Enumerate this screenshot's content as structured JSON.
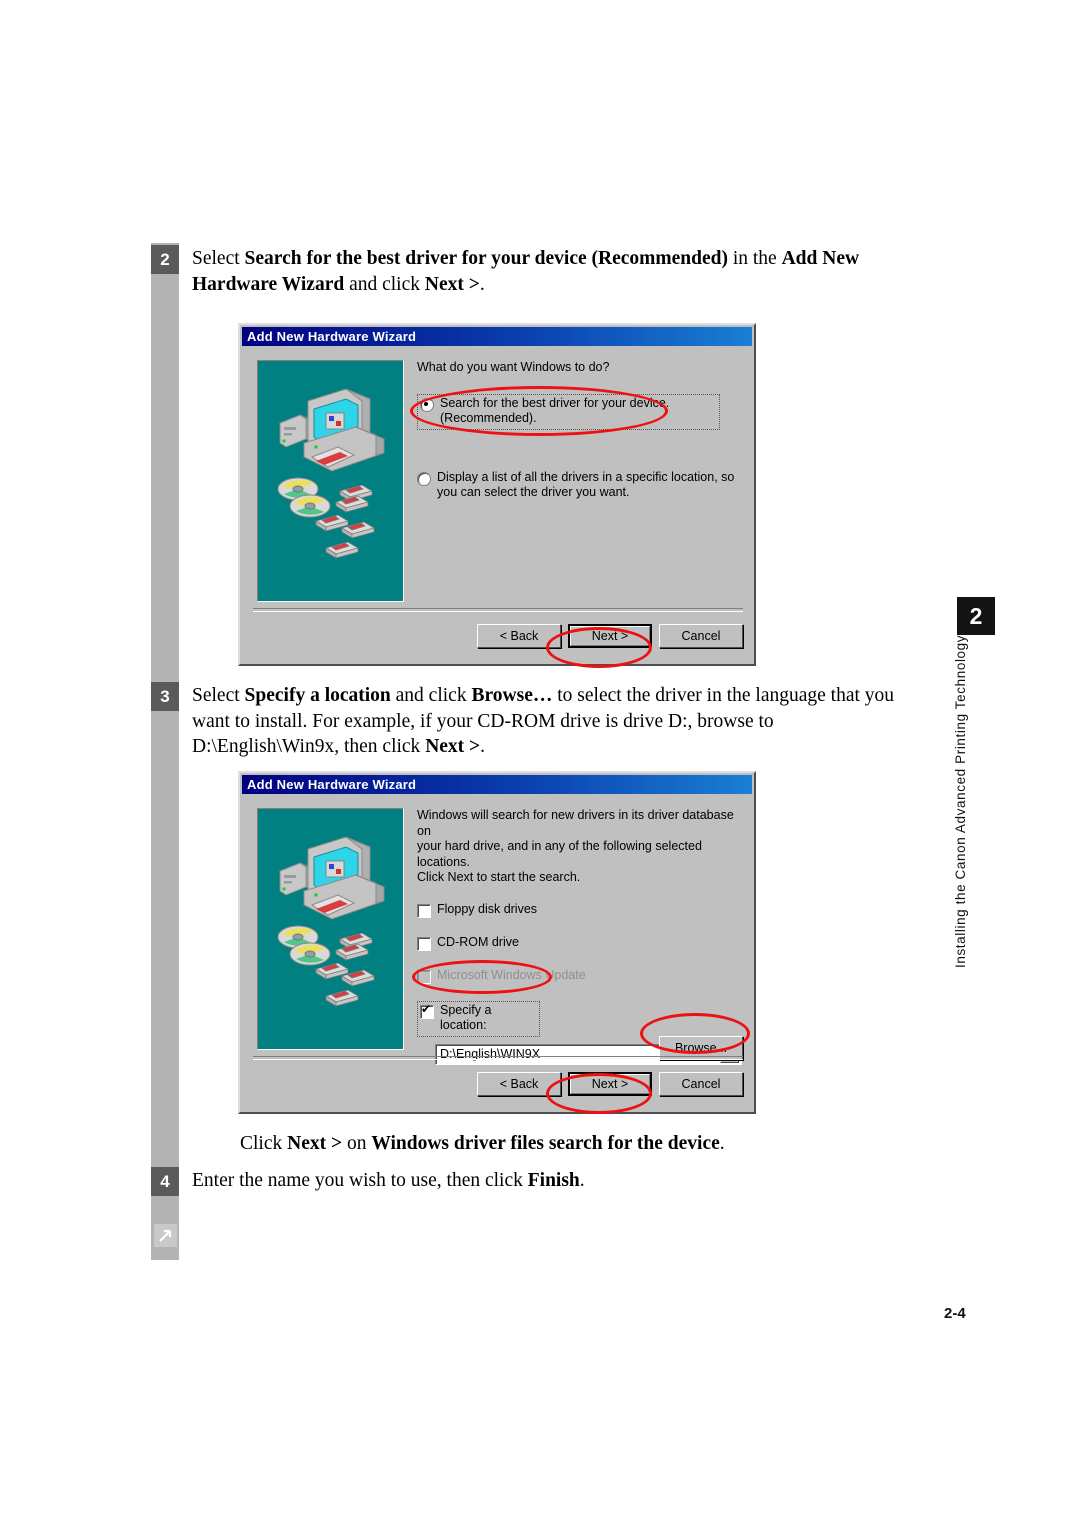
{
  "page": {
    "number": "2-4",
    "chapter_tab": "2",
    "side_label": "Installing the Canon Advanced Printing Technology",
    "rail_arrow_icon": "arrow-up-right-icon"
  },
  "steps": {
    "step2": {
      "marker": "2",
      "html": "Select <b>Search for the best driver for your device (Recommended)</b> in the <b>Add New Hardware Wizard</b> and click <b>Next &gt;</b>."
    },
    "step3": {
      "marker": "3",
      "html": "Select <b>Specify a location</b> and click <b>Browse&hellip;</b> to select the driver in the language that you want to install. For example, if your CD-ROM drive is drive D:, browse to D:\\English\\Win9x, then click <b>Next &gt;</b>."
    },
    "mid_note": {
      "html": "Click <b>Next &gt;</b> on <b>Windows driver files search for the device</b>."
    },
    "step4": {
      "marker": "4",
      "html": "Enter the name you wish to use, then click <b>Finish</b>."
    }
  },
  "dialog1": {
    "title": "Add New Hardware Wizard",
    "prompt": "What do you want Windows to do?",
    "options": [
      {
        "selected": true,
        "line1": "Search for the best driver for your device.",
        "line2": "(Recommended)."
      },
      {
        "selected": false,
        "line1": "Display a list of all the drivers in a specific location, so",
        "line2": "you can select the driver you want."
      }
    ],
    "buttons": {
      "back": "< Back",
      "next": "Next >",
      "cancel": "Cancel"
    }
  },
  "dialog2": {
    "title": "Add New Hardware Wizard",
    "intro_line1": "Windows will search for new drivers in its driver database on",
    "intro_line2": "your hard drive, and in any of the following selected locations.",
    "intro_line3": "Click Next to start the search.",
    "checkboxes": [
      {
        "label": "Floppy disk drives",
        "checked": false,
        "disabled": false
      },
      {
        "label": "CD-ROM drive",
        "checked": false,
        "disabled": false
      },
      {
        "label": "Microsoft Windows Update",
        "checked": false,
        "disabled": true
      },
      {
        "label": "Specify a location:",
        "checked": true,
        "disabled": false
      }
    ],
    "path_value": "D:\\English\\WIN9X",
    "browse_button": "Browse...",
    "buttons": {
      "back": "< Back",
      "next": "Next >",
      "cancel": "Cancel"
    }
  },
  "colors": {
    "highlight": "#ee1111",
    "titlebar_start": "#000080",
    "titlebar_end": "#1a7fd4",
    "illustration_bg": "#008080",
    "dialog_face": "#c0c0c0",
    "rail": "#b3b3b3",
    "marker": "#5a5a5a",
    "tab": "#131313"
  }
}
